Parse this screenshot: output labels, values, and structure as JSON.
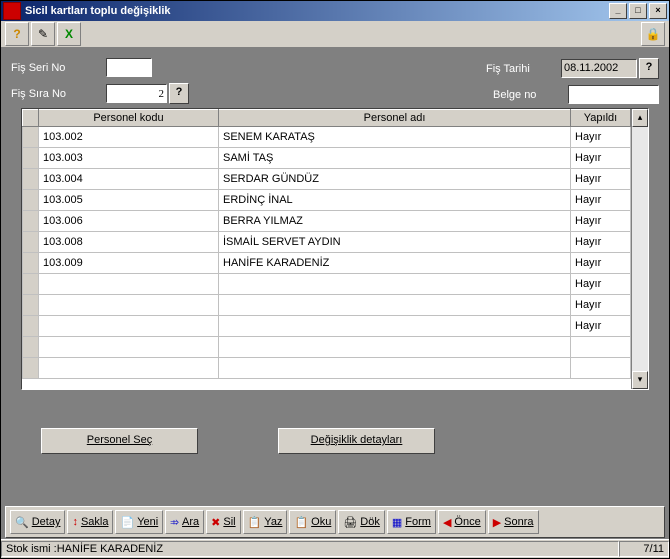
{
  "title": "Sicil kartları toplu değişiklik",
  "toolbar": {
    "help": "?",
    "edit": "✎",
    "excel": "X"
  },
  "fields": {
    "fis_seri_label": "Fiş Seri No",
    "fis_seri_value": "",
    "fis_sira_label": "Fiş Sıra No",
    "fis_sira_value": "2",
    "fis_tarihi_label": "Fiş Tarihi",
    "fis_tarihi_value": "08.11.2002",
    "belge_no_label": "Belge no",
    "belge_no_value": ""
  },
  "grid": {
    "columns": [
      "Personel kodu",
      "Personel adı",
      "Yapıldı"
    ],
    "rows": [
      {
        "code": "103.002",
        "name": "SENEM KARATAŞ",
        "done": "Hayır"
      },
      {
        "code": "103.003",
        "name": "SAMİ TAŞ",
        "done": "Hayır"
      },
      {
        "code": "103.004",
        "name": "SERDAR GÜNDÜZ",
        "done": "Hayır"
      },
      {
        "code": "103.005",
        "name": "ERDİNÇ İNAL",
        "done": "Hayır"
      },
      {
        "code": "103.006",
        "name": "BERRA YILMAZ",
        "done": "Hayır"
      },
      {
        "code": "103.008",
        "name": "İSMAİL SERVET AYDIN",
        "done": "Hayır"
      },
      {
        "code": "103.009",
        "name": "HANİFE KARADENİZ",
        "done": "Hayır"
      },
      {
        "code": "",
        "name": "",
        "done": "Hayır"
      },
      {
        "code": "",
        "name": "",
        "done": "Hayır"
      },
      {
        "code": "",
        "name": "",
        "done": "Hayır"
      },
      {
        "code": "",
        "name": "",
        "done": ""
      },
      {
        "code": "",
        "name": "",
        "done": ""
      }
    ]
  },
  "buttons": {
    "personel_sec": "Personel Seç",
    "degisiklik_detaylari": "Değişiklik detayları"
  },
  "bottom": {
    "detay": "Detay",
    "sakla": "Sakla",
    "yeni": "Yeni",
    "ara": "Ara",
    "sil": "Sil",
    "yaz": "Yaz",
    "oku": "Oku",
    "dok": "Dök",
    "form": "Form",
    "once": "Önce",
    "sonra": "Sonra"
  },
  "status": {
    "left": "Stok ismi :HANİFE KARADENİZ",
    "right": "7/11"
  }
}
